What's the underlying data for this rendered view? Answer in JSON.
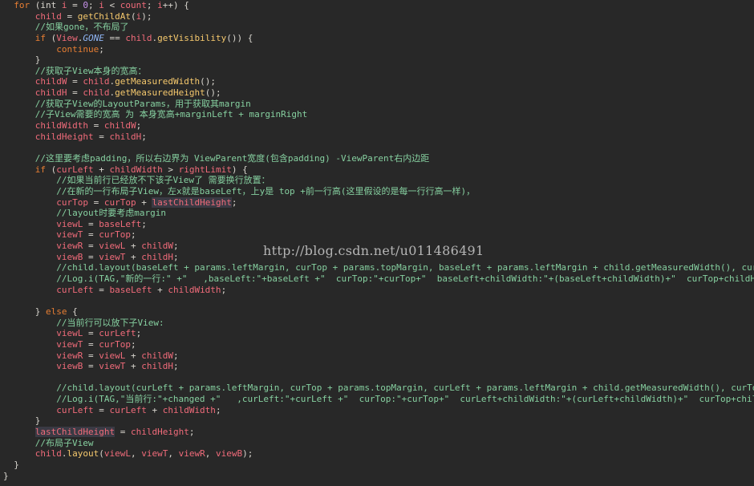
{
  "watermark": "http://blog.csdn.net/u011486491",
  "lines": [
    [
      {
        "t": "  ",
        "c": "txt"
      },
      {
        "t": "for",
        "c": "kw"
      },
      {
        "t": " (int ",
        "c": "txt"
      },
      {
        "t": "i",
        "c": "var"
      },
      {
        "t": " = ",
        "c": "txt"
      },
      {
        "t": "0",
        "c": "num"
      },
      {
        "t": "; ",
        "c": "txt"
      },
      {
        "t": "i",
        "c": "var"
      },
      {
        "t": " < ",
        "c": "txt"
      },
      {
        "t": "count",
        "c": "var"
      },
      {
        "t": "; ",
        "c": "txt"
      },
      {
        "t": "i",
        "c": "var"
      },
      {
        "t": "++) {",
        "c": "txt"
      }
    ],
    [
      {
        "t": "      ",
        "c": "txt"
      },
      {
        "t": "child",
        "c": "var"
      },
      {
        "t": " = ",
        "c": "txt"
      },
      {
        "t": "getChildAt",
        "c": "fn"
      },
      {
        "t": "(",
        "c": "txt"
      },
      {
        "t": "i",
        "c": "var"
      },
      {
        "t": ");",
        "c": "txt"
      }
    ],
    [
      {
        "t": "      ",
        "c": "txt"
      },
      {
        "t": "//如果gone，不布局了",
        "c": "cm"
      }
    ],
    [
      {
        "t": "      ",
        "c": "txt"
      },
      {
        "t": "if",
        "c": "kw"
      },
      {
        "t": " (",
        "c": "txt"
      },
      {
        "t": "View",
        "c": "var"
      },
      {
        "t": ".",
        "c": "txt"
      },
      {
        "t": "GONE",
        "c": "const"
      },
      {
        "t": " == ",
        "c": "txt"
      },
      {
        "t": "child",
        "c": "var"
      },
      {
        "t": ".",
        "c": "txt"
      },
      {
        "t": "getVisibility",
        "c": "fn"
      },
      {
        "t": "()) {",
        "c": "txt"
      }
    ],
    [
      {
        "t": "          ",
        "c": "txt"
      },
      {
        "t": "continue",
        "c": "kw"
      },
      {
        "t": ";",
        "c": "txt"
      }
    ],
    [
      {
        "t": "      }",
        "c": "txt"
      }
    ],
    [
      {
        "t": "      ",
        "c": "txt"
      },
      {
        "t": "//获取子View本身的宽高：",
        "c": "cm"
      }
    ],
    [
      {
        "t": "      ",
        "c": "txt"
      },
      {
        "t": "childW",
        "c": "var"
      },
      {
        "t": " = ",
        "c": "txt"
      },
      {
        "t": "child",
        "c": "var"
      },
      {
        "t": ".",
        "c": "txt"
      },
      {
        "t": "getMeasuredWidth",
        "c": "fn"
      },
      {
        "t": "();",
        "c": "txt"
      }
    ],
    [
      {
        "t": "      ",
        "c": "txt"
      },
      {
        "t": "childH",
        "c": "var"
      },
      {
        "t": " = ",
        "c": "txt"
      },
      {
        "t": "child",
        "c": "var"
      },
      {
        "t": ".",
        "c": "txt"
      },
      {
        "t": "getMeasuredHeight",
        "c": "fn"
      },
      {
        "t": "();",
        "c": "txt"
      }
    ],
    [
      {
        "t": "      ",
        "c": "txt"
      },
      {
        "t": "//获取子View的LayoutParams，用于获取其margin",
        "c": "cm"
      }
    ],
    [
      {
        "t": "      ",
        "c": "txt"
      },
      {
        "t": "//子View需要的宽高 为 本身宽高+marginLeft + marginRight",
        "c": "cm"
      }
    ],
    [
      {
        "t": "      ",
        "c": "txt"
      },
      {
        "t": "childWidth",
        "c": "var"
      },
      {
        "t": " = ",
        "c": "txt"
      },
      {
        "t": "childW",
        "c": "var"
      },
      {
        "t": ";",
        "c": "txt"
      }
    ],
    [
      {
        "t": "      ",
        "c": "txt"
      },
      {
        "t": "childHeight",
        "c": "var"
      },
      {
        "t": " = ",
        "c": "txt"
      },
      {
        "t": "childH",
        "c": "var"
      },
      {
        "t": ";",
        "c": "txt"
      }
    ],
    [
      {
        "t": "",
        "c": "txt"
      }
    ],
    [
      {
        "t": "      ",
        "c": "txt"
      },
      {
        "t": "//这里要考虑padding，所以右边界为 ViewParent宽度(包含padding) -ViewParent右内边距",
        "c": "cm"
      }
    ],
    [
      {
        "t": "      ",
        "c": "txt"
      },
      {
        "t": "if",
        "c": "kw"
      },
      {
        "t": " (",
        "c": "txt"
      },
      {
        "t": "curLeft",
        "c": "var"
      },
      {
        "t": " + ",
        "c": "txt"
      },
      {
        "t": "childWidth",
        "c": "var"
      },
      {
        "t": " > ",
        "c": "txt"
      },
      {
        "t": "rightLimit",
        "c": "var"
      },
      {
        "t": ") {",
        "c": "txt"
      }
    ],
    [
      {
        "t": "          ",
        "c": "txt"
      },
      {
        "t": "//如果当前行已经放不下该子View了 需要换行放置：",
        "c": "cm"
      }
    ],
    [
      {
        "t": "          ",
        "c": "txt"
      },
      {
        "t": "//在新的一行布局子View，左x就是baseLeft，上y是 top +前一行高(这里假设的是每一行行高一样)，",
        "c": "cm"
      }
    ],
    [
      {
        "t": "          ",
        "c": "txt"
      },
      {
        "t": "curTop",
        "c": "var"
      },
      {
        "t": " = ",
        "c": "txt"
      },
      {
        "t": "curTop",
        "c": "var"
      },
      {
        "t": " + ",
        "c": "txt"
      },
      {
        "t": "lastChildHeight",
        "c": "var",
        "hl": true
      },
      {
        "t": ";",
        "c": "txt"
      }
    ],
    [
      {
        "t": "          ",
        "c": "txt"
      },
      {
        "t": "//layout时要考虑margin",
        "c": "cm"
      }
    ],
    [
      {
        "t": "          ",
        "c": "txt"
      },
      {
        "t": "viewL",
        "c": "var"
      },
      {
        "t": " = ",
        "c": "txt"
      },
      {
        "t": "baseLeft",
        "c": "var"
      },
      {
        "t": ";",
        "c": "txt"
      }
    ],
    [
      {
        "t": "          ",
        "c": "txt"
      },
      {
        "t": "viewT",
        "c": "var"
      },
      {
        "t": " = ",
        "c": "txt"
      },
      {
        "t": "curTop",
        "c": "var"
      },
      {
        "t": ";",
        "c": "txt"
      }
    ],
    [
      {
        "t": "          ",
        "c": "txt"
      },
      {
        "t": "viewR",
        "c": "var"
      },
      {
        "t": " = ",
        "c": "txt"
      },
      {
        "t": "viewL",
        "c": "var"
      },
      {
        "t": " + ",
        "c": "txt"
      },
      {
        "t": "childW",
        "c": "var"
      },
      {
        "t": ";",
        "c": "txt"
      }
    ],
    [
      {
        "t": "          ",
        "c": "txt"
      },
      {
        "t": "viewB",
        "c": "var"
      },
      {
        "t": " = ",
        "c": "txt"
      },
      {
        "t": "viewT",
        "c": "var"
      },
      {
        "t": " + ",
        "c": "txt"
      },
      {
        "t": "childH",
        "c": "var"
      },
      {
        "t": ";",
        "c": "txt"
      }
    ],
    [
      {
        "t": "          ",
        "c": "txt"
      },
      {
        "t": "//child.layout(baseLeft + params.leftMargin, curTop + params.topMargin, baseLeft + params.leftMargin + child.getMeasuredWidth(), curTop + params.",
        "c": "cm"
      }
    ],
    [
      {
        "t": "          ",
        "c": "txt"
      },
      {
        "t": "//Log.i(TAG,\"新的一行:\" +\"   ,baseLeft:\"+baseLeft +\"  curTop:\"+curTop+\"  baseLeft+childWidth:\"+(baseLeft+childWidth)+\"  curTop+childHeight:\"+ ( cu",
        "c": "cm"
      }
    ],
    [
      {
        "t": "          ",
        "c": "txt"
      },
      {
        "t": "curLeft",
        "c": "var"
      },
      {
        "t": " = ",
        "c": "txt"
      },
      {
        "t": "baseLeft",
        "c": "var"
      },
      {
        "t": " + ",
        "c": "txt"
      },
      {
        "t": "childWidth",
        "c": "var"
      },
      {
        "t": ";",
        "c": "txt"
      }
    ],
    [
      {
        "t": "",
        "c": "txt"
      }
    ],
    [
      {
        "t": "      } ",
        "c": "txt"
      },
      {
        "t": "else",
        "c": "kw"
      },
      {
        "t": " {",
        "c": "txt"
      }
    ],
    [
      {
        "t": "          ",
        "c": "txt"
      },
      {
        "t": "//当前行可以放下子View:",
        "c": "cm"
      }
    ],
    [
      {
        "t": "          ",
        "c": "txt"
      },
      {
        "t": "viewL",
        "c": "var"
      },
      {
        "t": " = ",
        "c": "txt"
      },
      {
        "t": "curLeft",
        "c": "var"
      },
      {
        "t": ";",
        "c": "txt"
      }
    ],
    [
      {
        "t": "          ",
        "c": "txt"
      },
      {
        "t": "viewT",
        "c": "var"
      },
      {
        "t": " = ",
        "c": "txt"
      },
      {
        "t": "curTop",
        "c": "var"
      },
      {
        "t": ";",
        "c": "txt"
      }
    ],
    [
      {
        "t": "          ",
        "c": "txt"
      },
      {
        "t": "viewR",
        "c": "var"
      },
      {
        "t": " = ",
        "c": "txt"
      },
      {
        "t": "viewL",
        "c": "var"
      },
      {
        "t": " + ",
        "c": "txt"
      },
      {
        "t": "childW",
        "c": "var"
      },
      {
        "t": ";",
        "c": "txt"
      }
    ],
    [
      {
        "t": "          ",
        "c": "txt"
      },
      {
        "t": "viewB",
        "c": "var"
      },
      {
        "t": " = ",
        "c": "txt"
      },
      {
        "t": "viewT",
        "c": "var"
      },
      {
        "t": " + ",
        "c": "txt"
      },
      {
        "t": "childH",
        "c": "var"
      },
      {
        "t": ";",
        "c": "txt"
      }
    ],
    [
      {
        "t": "",
        "c": "txt"
      }
    ],
    [
      {
        "t": "          ",
        "c": "txt"
      },
      {
        "t": "//child.layout(curLeft + params.leftMargin, curTop + params.topMargin, curLeft + params.leftMargin + child.getMeasuredWidth(), curTop + params.to",
        "c": "cm"
      }
    ],
    [
      {
        "t": "          ",
        "c": "txt"
      },
      {
        "t": "//Log.i(TAG,\"当前行:\"+changed +\"   ,curLeft:\"+curLeft +\"  curTop:\"+curTop+\"  curLeft+childWidth:\"+(curLeft+childWidth)+\"  curTop+childHeight:\"+(cu",
        "c": "cm"
      }
    ],
    [
      {
        "t": "          ",
        "c": "txt"
      },
      {
        "t": "curLeft",
        "c": "var"
      },
      {
        "t": " = ",
        "c": "txt"
      },
      {
        "t": "curLeft",
        "c": "var"
      },
      {
        "t": " + ",
        "c": "txt"
      },
      {
        "t": "childWidth",
        "c": "var"
      },
      {
        "t": ";",
        "c": "txt"
      }
    ],
    [
      {
        "t": "      }",
        "c": "txt"
      }
    ],
    [
      {
        "t": "      ",
        "c": "txt"
      },
      {
        "t": "lastChildHeight",
        "c": "var",
        "hl": true
      },
      {
        "t": " = ",
        "c": "txt"
      },
      {
        "t": "childHeight",
        "c": "var"
      },
      {
        "t": ";",
        "c": "txt"
      }
    ],
    [
      {
        "t": "      ",
        "c": "txt"
      },
      {
        "t": "//布局子View",
        "c": "cm"
      }
    ],
    [
      {
        "t": "      ",
        "c": "txt"
      },
      {
        "t": "child",
        "c": "var"
      },
      {
        "t": ".",
        "c": "txt"
      },
      {
        "t": "layout",
        "c": "fn"
      },
      {
        "t": "(",
        "c": "txt"
      },
      {
        "t": "viewL",
        "c": "var"
      },
      {
        "t": ", ",
        "c": "txt"
      },
      {
        "t": "viewT",
        "c": "var"
      },
      {
        "t": ", ",
        "c": "txt"
      },
      {
        "t": "viewR",
        "c": "var"
      },
      {
        "t": ", ",
        "c": "txt"
      },
      {
        "t": "viewB",
        "c": "var"
      },
      {
        "t": ");",
        "c": "txt"
      }
    ],
    [
      {
        "t": "  }",
        "c": "txt"
      }
    ],
    [
      {
        "t": "}",
        "c": "txt"
      }
    ]
  ]
}
